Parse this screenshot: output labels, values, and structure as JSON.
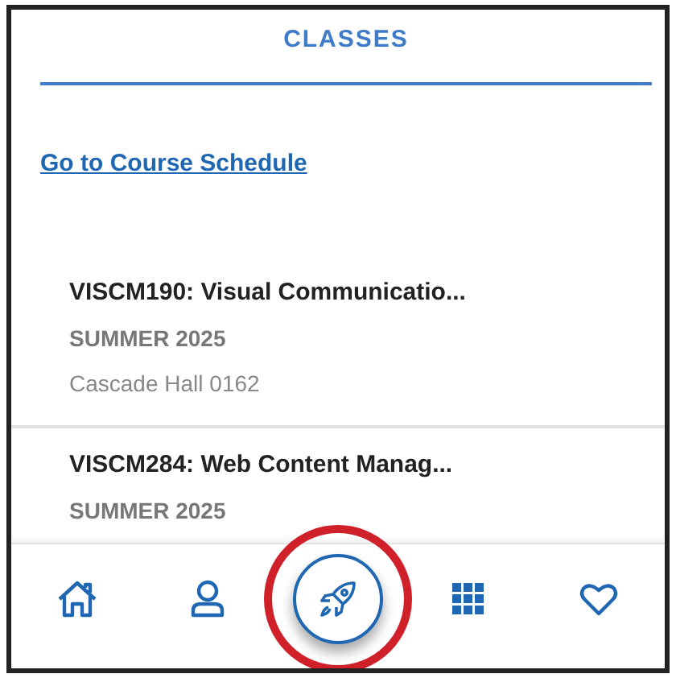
{
  "header": {
    "title": "CLASSES"
  },
  "link": "Go to Course Schedule",
  "classes": [
    {
      "name": "VISCM190: Visual Communicatio...",
      "term": "SUMMER 2025",
      "room": "Cascade Hall 0162"
    },
    {
      "name": "VISCM284: Web Content Manag...",
      "term": "SUMMER 2025"
    }
  ],
  "nav": [
    {
      "kind": "home",
      "selected": false,
      "circled": false
    },
    {
      "kind": "profile",
      "selected": false,
      "circled": false
    },
    {
      "kind": "rocket",
      "selected": true,
      "circled": true
    },
    {
      "kind": "grid",
      "selected": false,
      "circled": false
    },
    {
      "kind": "heart",
      "selected": false,
      "circled": false
    }
  ]
}
